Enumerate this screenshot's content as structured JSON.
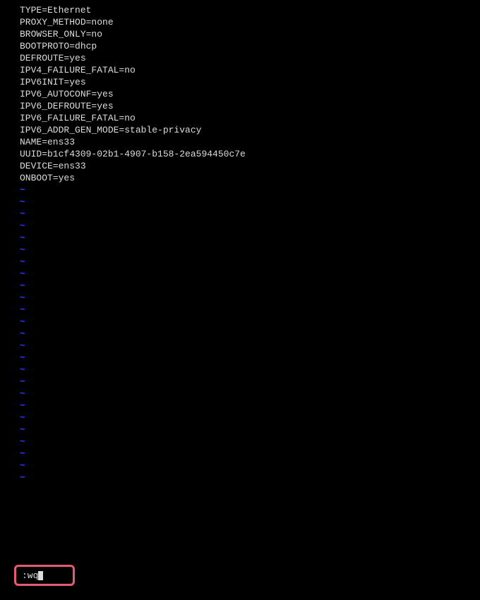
{
  "config_lines": [
    "TYPE=Ethernet",
    "PROXY_METHOD=none",
    "BROWSER_ONLY=no",
    "BOOTPROTO=dhcp",
    "DEFROUTE=yes",
    "IPV4_FAILURE_FATAL=no",
    "IPV6INIT=yes",
    "IPV6_AUTOCONF=yes",
    "IPV6_DEFROUTE=yes",
    "IPV6_FAILURE_FATAL=no",
    "IPV6_ADDR_GEN_MODE=stable-privacy",
    "NAME=ens33",
    "UUID=b1cf4309-02b1-4907-b158-2ea594450c7e",
    "DEVICE=ens33",
    "ONBOOT=yes"
  ],
  "tilde": "~",
  "tilde_count": 25,
  "command": ":wq"
}
